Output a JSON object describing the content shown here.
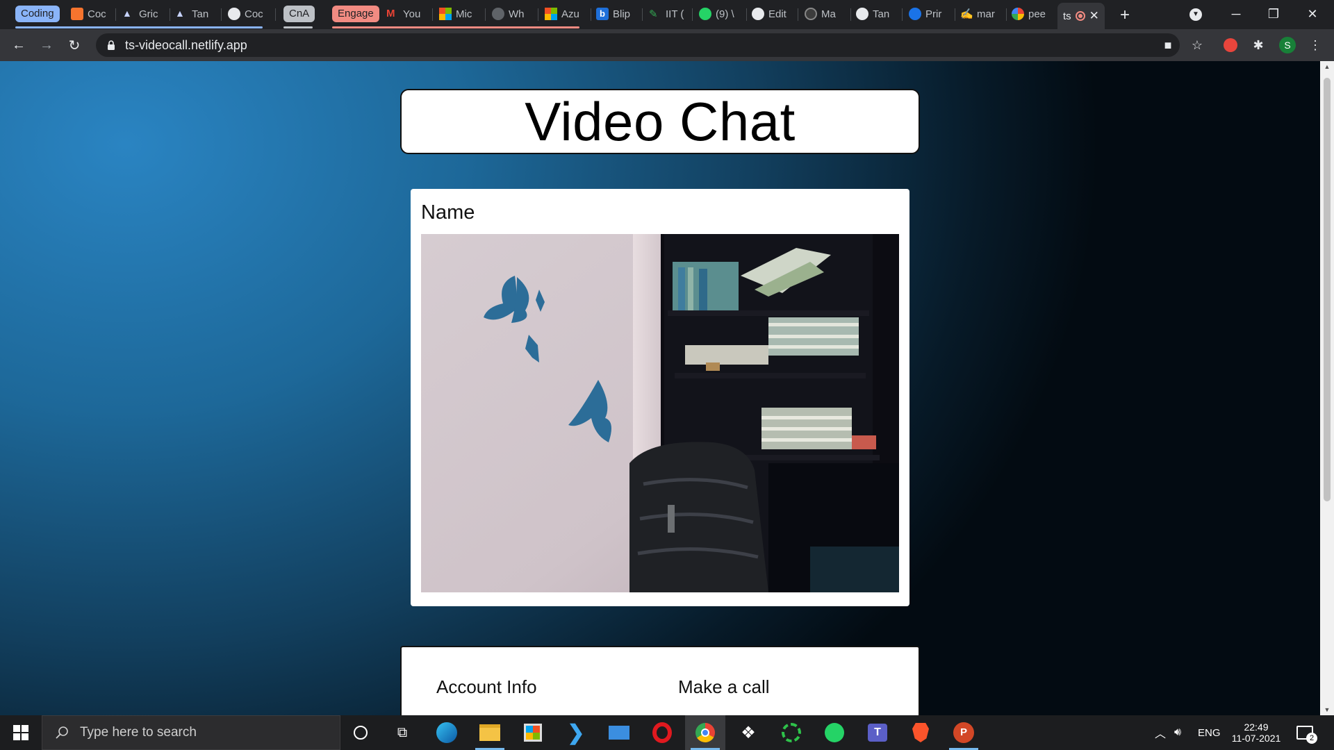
{
  "browser": {
    "tab_groups": [
      {
        "label": "Coding",
        "color": "#8ab4f8"
      },
      {
        "label": "CnA",
        "color": "#bdc1c6"
      },
      {
        "label": "Engage",
        "color": "#f28b82"
      }
    ],
    "tabs": [
      "Coc",
      "Gric",
      "Tan",
      "Coc",
      "You",
      "Mic",
      "Wh",
      "Azu",
      "Blip",
      "IIT (",
      "(9) \\",
      "Edit",
      "Ma",
      "Tan",
      "Prir",
      "mar",
      "pee"
    ],
    "active_tab": "ts",
    "url": "ts-videocall.netlify.app",
    "profile_initial": "S"
  },
  "page": {
    "title": "Video Chat",
    "video_caption": "Name",
    "account_info_label": "Account Info",
    "make_call_label": "Make a call"
  },
  "taskbar": {
    "search_placeholder": "Type here to search",
    "language": "ENG",
    "time": "22:49",
    "date": "11-07-2021",
    "notification_count": "2"
  },
  "colors": {
    "page_bg_light": "#2a84c2",
    "page_bg_dark": "#030b12",
    "accent_chrome": "#8ab4f8"
  }
}
